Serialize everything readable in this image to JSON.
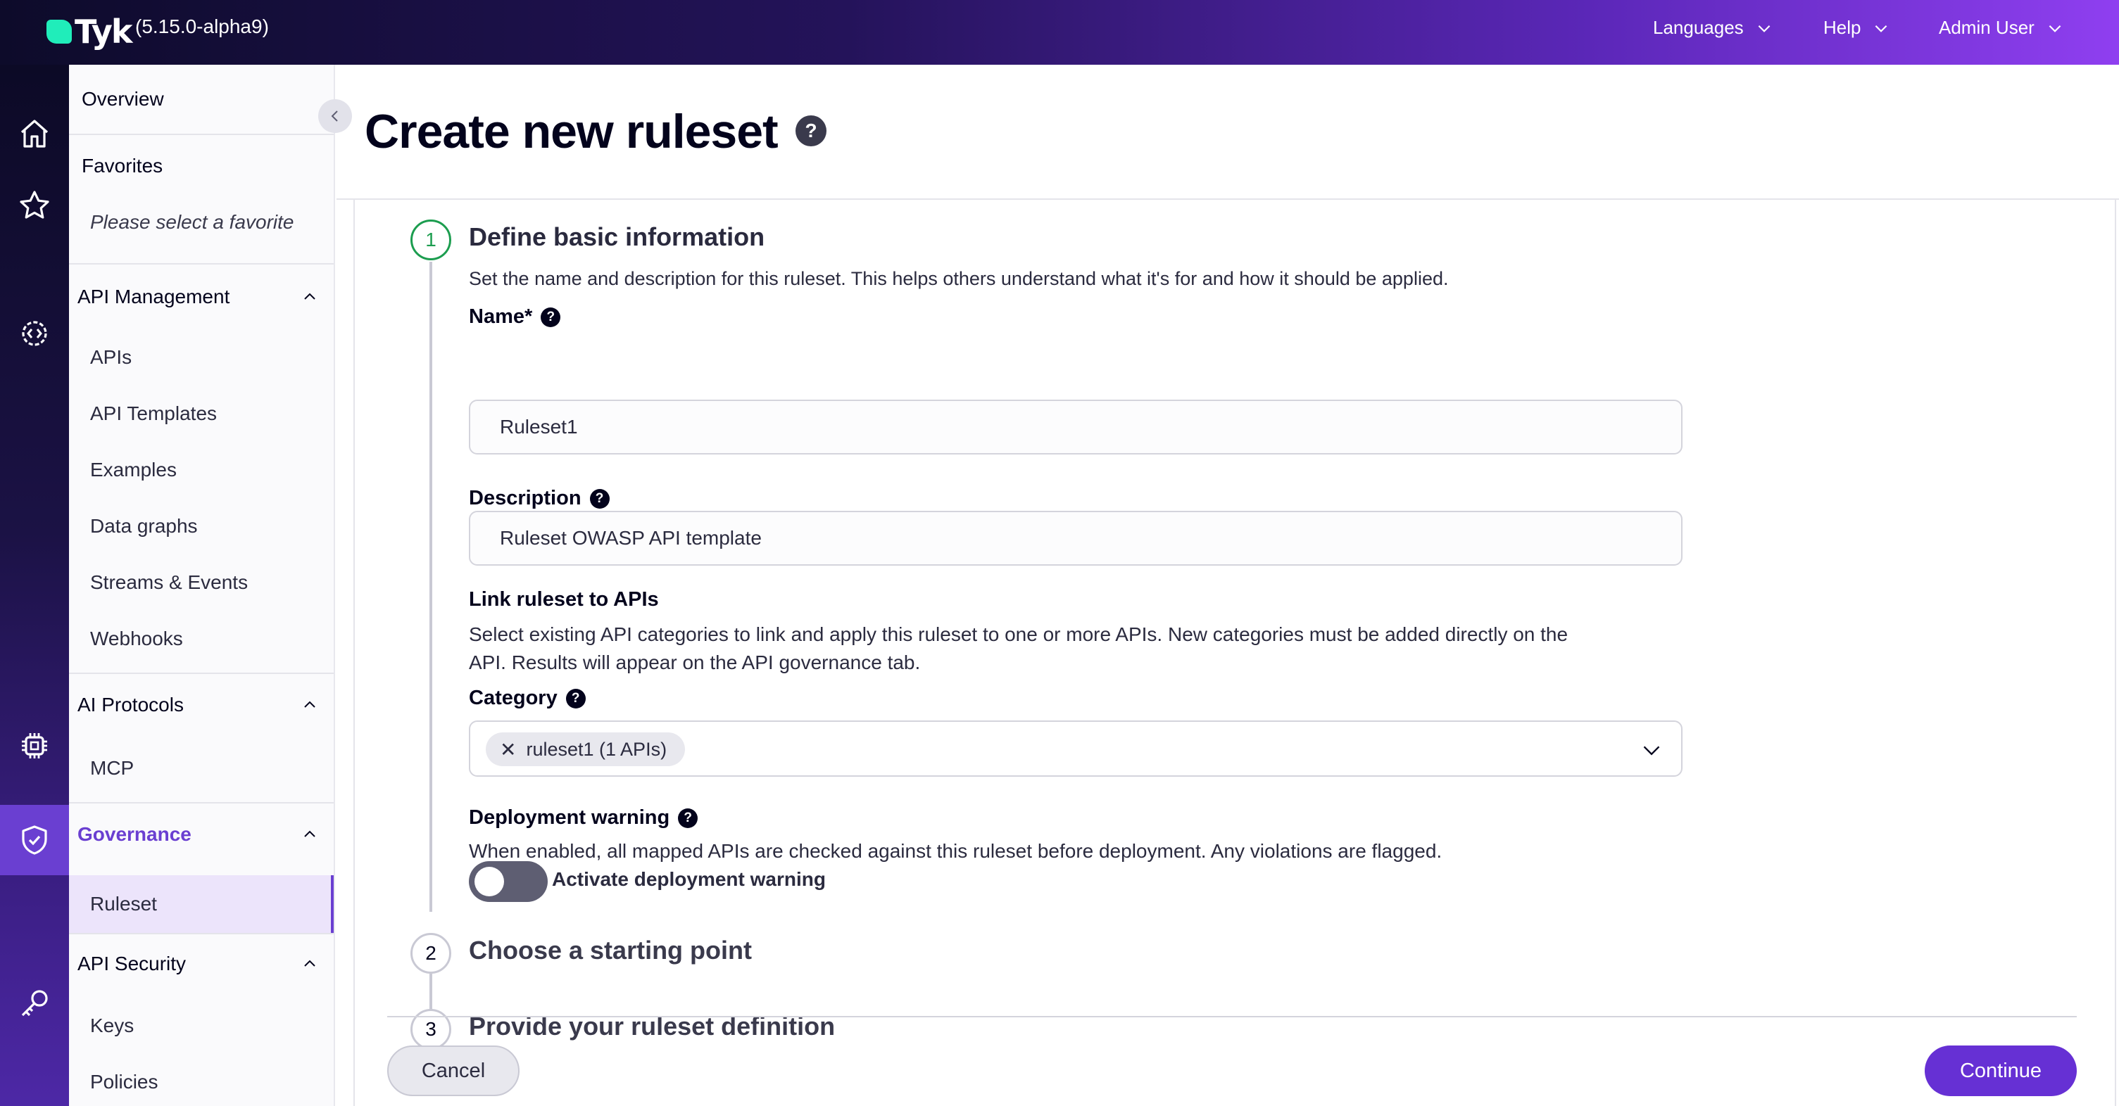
{
  "app": {
    "logo_text": "Tyk",
    "version": "(5.15.0-alpha9)"
  },
  "topbar": {
    "languages": "Languages",
    "help": "Help",
    "user": "Admin User"
  },
  "rail": {
    "icons": [
      "home-icon",
      "star-icon",
      "gear-code-icon",
      "chip-icon",
      "shield-check-icon",
      "key-icon"
    ],
    "active": "shield-check-icon"
  },
  "sidebar": {
    "overview": "Overview",
    "favorites": "Favorites",
    "favorites_placeholder": "Please select a favorite",
    "sections": [
      {
        "title": "API Management",
        "items": [
          "APIs",
          "API Templates",
          "Examples",
          "Data graphs",
          "Streams & Events",
          "Webhooks"
        ]
      },
      {
        "title": "AI Protocols",
        "items": [
          "MCP"
        ]
      },
      {
        "title": "Governance",
        "items": [
          "Ruleset"
        ]
      },
      {
        "title": "API Security",
        "items": [
          "Keys",
          "Policies"
        ]
      }
    ],
    "active_section": "Governance",
    "active_item": "Ruleset"
  },
  "page": {
    "title": "Create new ruleset",
    "help_glyph": "?"
  },
  "steps": [
    {
      "number": "1",
      "title": "Define basic information"
    },
    {
      "number": "2",
      "title": "Choose a starting point"
    },
    {
      "number": "3",
      "title": "Provide your ruleset definition"
    }
  ],
  "form": {
    "intro": "Set the name and description for this ruleset. This helps others understand what it's for and how it should be applied.",
    "name_label": "Name*",
    "name_value": "Ruleset1",
    "description_label": "Description",
    "description_value": "Ruleset OWASP API template",
    "link_heading": "Link ruleset to APIs",
    "link_text_line1": "Select existing API categories to link and apply this ruleset to one or more APIs. New categories must be added directly on the",
    "link_text_line2": "API. Results will appear on the API governance tab.",
    "category_label": "Category",
    "category_chip": "ruleset1 (1 APIs)",
    "chip_remove_glyph": "✕",
    "deployment_label": "Deployment warning",
    "deployment_text": "When enabled, all mapped APIs are checked against this ruleset before deployment. Any violations are flagged.",
    "deployment_toggle_label": "Activate deployment warning",
    "deployment_toggle_on": false
  },
  "footer": {
    "cancel": "Cancel",
    "continue": "Continue"
  },
  "colors": {
    "accent": "#6630d4",
    "active_step": "#1c9d4f",
    "governance_text": "#6a3fd1"
  }
}
